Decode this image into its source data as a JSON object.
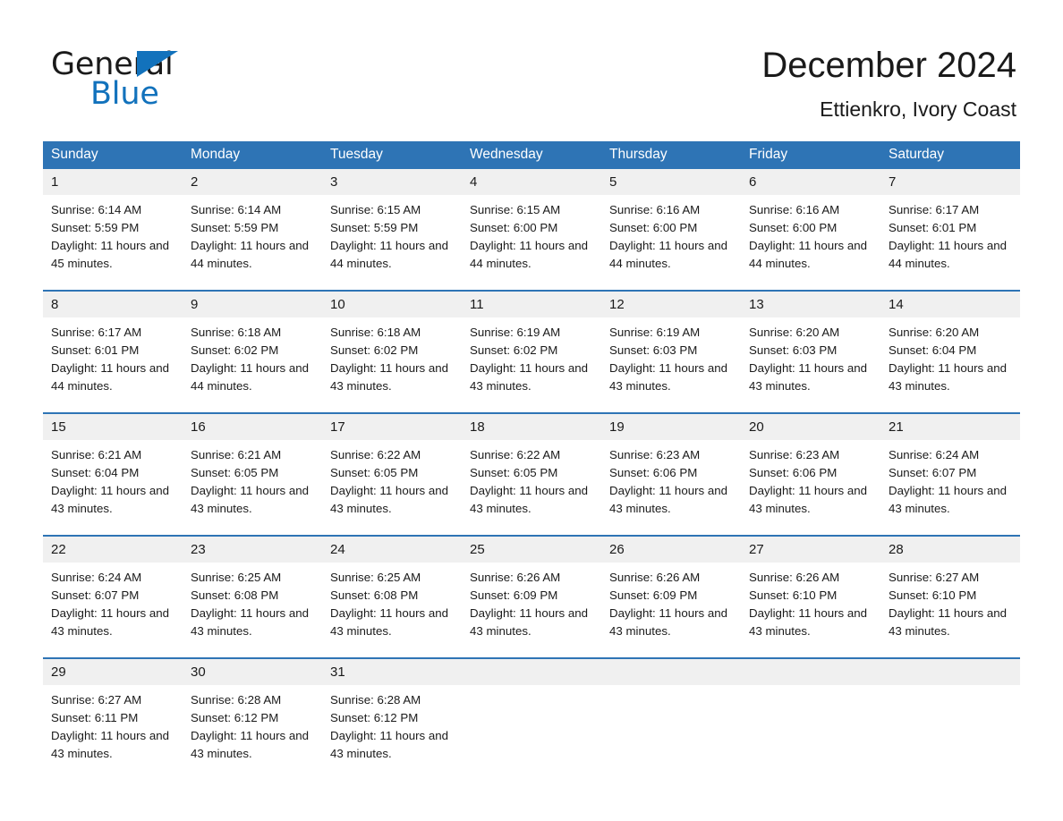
{
  "brand": {
    "word_one": "General",
    "word_two": "Blue",
    "triangle_icon": "triangle-icon",
    "accent_color": "#1272bc"
  },
  "header": {
    "title": "December 2024",
    "location": "Ettienkro, Ivory Coast"
  },
  "theme": {
    "header_blue": "#2e74b5",
    "daynum_band": "#f0f0f0",
    "text": "#1a1a1a"
  },
  "calendar": {
    "weekday_headers": [
      "Sunday",
      "Monday",
      "Tuesday",
      "Wednesday",
      "Thursday",
      "Friday",
      "Saturday"
    ],
    "weeks": [
      [
        {
          "day": "1",
          "details": "Sunrise: 6:14 AM\nSunset: 5:59 PM\nDaylight: 11 hours and 45 minutes."
        },
        {
          "day": "2",
          "details": "Sunrise: 6:14 AM\nSunset: 5:59 PM\nDaylight: 11 hours and 44 minutes."
        },
        {
          "day": "3",
          "details": "Sunrise: 6:15 AM\nSunset: 5:59 PM\nDaylight: 11 hours and 44 minutes."
        },
        {
          "day": "4",
          "details": "Sunrise: 6:15 AM\nSunset: 6:00 PM\nDaylight: 11 hours and 44 minutes."
        },
        {
          "day": "5",
          "details": "Sunrise: 6:16 AM\nSunset: 6:00 PM\nDaylight: 11 hours and 44 minutes."
        },
        {
          "day": "6",
          "details": "Sunrise: 6:16 AM\nSunset: 6:00 PM\nDaylight: 11 hours and 44 minutes."
        },
        {
          "day": "7",
          "details": "Sunrise: 6:17 AM\nSunset: 6:01 PM\nDaylight: 11 hours and 44 minutes."
        }
      ],
      [
        {
          "day": "8",
          "details": "Sunrise: 6:17 AM\nSunset: 6:01 PM\nDaylight: 11 hours and 44 minutes."
        },
        {
          "day": "9",
          "details": "Sunrise: 6:18 AM\nSunset: 6:02 PM\nDaylight: 11 hours and 44 minutes."
        },
        {
          "day": "10",
          "details": "Sunrise: 6:18 AM\nSunset: 6:02 PM\nDaylight: 11 hours and 43 minutes."
        },
        {
          "day": "11",
          "details": "Sunrise: 6:19 AM\nSunset: 6:02 PM\nDaylight: 11 hours and 43 minutes."
        },
        {
          "day": "12",
          "details": "Sunrise: 6:19 AM\nSunset: 6:03 PM\nDaylight: 11 hours and 43 minutes."
        },
        {
          "day": "13",
          "details": "Sunrise: 6:20 AM\nSunset: 6:03 PM\nDaylight: 11 hours and 43 minutes."
        },
        {
          "day": "14",
          "details": "Sunrise: 6:20 AM\nSunset: 6:04 PM\nDaylight: 11 hours and 43 minutes."
        }
      ],
      [
        {
          "day": "15",
          "details": "Sunrise: 6:21 AM\nSunset: 6:04 PM\nDaylight: 11 hours and 43 minutes."
        },
        {
          "day": "16",
          "details": "Sunrise: 6:21 AM\nSunset: 6:05 PM\nDaylight: 11 hours and 43 minutes."
        },
        {
          "day": "17",
          "details": "Sunrise: 6:22 AM\nSunset: 6:05 PM\nDaylight: 11 hours and 43 minutes."
        },
        {
          "day": "18",
          "details": "Sunrise: 6:22 AM\nSunset: 6:05 PM\nDaylight: 11 hours and 43 minutes."
        },
        {
          "day": "19",
          "details": "Sunrise: 6:23 AM\nSunset: 6:06 PM\nDaylight: 11 hours and 43 minutes."
        },
        {
          "day": "20",
          "details": "Sunrise: 6:23 AM\nSunset: 6:06 PM\nDaylight: 11 hours and 43 minutes."
        },
        {
          "day": "21",
          "details": "Sunrise: 6:24 AM\nSunset: 6:07 PM\nDaylight: 11 hours and 43 minutes."
        }
      ],
      [
        {
          "day": "22",
          "details": "Sunrise: 6:24 AM\nSunset: 6:07 PM\nDaylight: 11 hours and 43 minutes."
        },
        {
          "day": "23",
          "details": "Sunrise: 6:25 AM\nSunset: 6:08 PM\nDaylight: 11 hours and 43 minutes."
        },
        {
          "day": "24",
          "details": "Sunrise: 6:25 AM\nSunset: 6:08 PM\nDaylight: 11 hours and 43 minutes."
        },
        {
          "day": "25",
          "details": "Sunrise: 6:26 AM\nSunset: 6:09 PM\nDaylight: 11 hours and 43 minutes."
        },
        {
          "day": "26",
          "details": "Sunrise: 6:26 AM\nSunset: 6:09 PM\nDaylight: 11 hours and 43 minutes."
        },
        {
          "day": "27",
          "details": "Sunrise: 6:26 AM\nSunset: 6:10 PM\nDaylight: 11 hours and 43 minutes."
        },
        {
          "day": "28",
          "details": "Sunrise: 6:27 AM\nSunset: 6:10 PM\nDaylight: 11 hours and 43 minutes."
        }
      ],
      [
        {
          "day": "29",
          "details": "Sunrise: 6:27 AM\nSunset: 6:11 PM\nDaylight: 11 hours and 43 minutes."
        },
        {
          "day": "30",
          "details": "Sunrise: 6:28 AM\nSunset: 6:12 PM\nDaylight: 11 hours and 43 minutes."
        },
        {
          "day": "31",
          "details": "Sunrise: 6:28 AM\nSunset: 6:12 PM\nDaylight: 11 hours and 43 minutes."
        },
        {
          "day": "",
          "details": ""
        },
        {
          "day": "",
          "details": ""
        },
        {
          "day": "",
          "details": ""
        },
        {
          "day": "",
          "details": ""
        }
      ]
    ]
  }
}
